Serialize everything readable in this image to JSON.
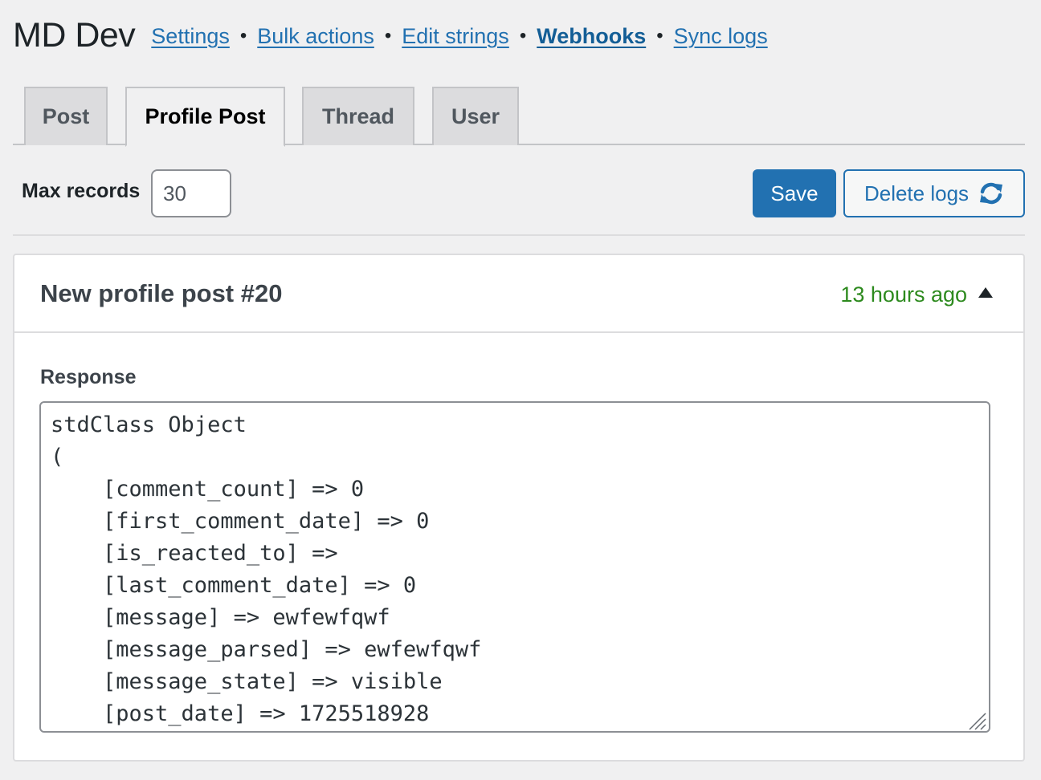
{
  "header": {
    "app_title": "MD Dev",
    "nav": [
      {
        "label": "Settings",
        "current": false
      },
      {
        "label": "Bulk actions",
        "current": false
      },
      {
        "label": "Edit strings",
        "current": false
      },
      {
        "label": "Webhooks",
        "current": true
      },
      {
        "label": "Sync logs",
        "current": false
      }
    ],
    "separator": "•"
  },
  "tabs": [
    {
      "label": "Post",
      "active": false
    },
    {
      "label": "Profile Post",
      "active": true
    },
    {
      "label": "Thread",
      "active": false
    },
    {
      "label": "User",
      "active": false
    }
  ],
  "settings": {
    "max_records_label": "Max records",
    "max_records_value": "30",
    "save_label": "Save",
    "delete_logs_label": "Delete logs",
    "delete_icon": "refresh-icon"
  },
  "log": {
    "title": "New profile post #20",
    "time": "13 hours ago",
    "expanded": true,
    "response_label": "Response",
    "response_lines": [
      "stdClass Object",
      "(",
      "    [comment_count] => 0",
      "    [first_comment_date] => 0",
      "    [is_reacted_to] =>",
      "    [last_comment_date] => 0",
      "    [message] => ewfewfqwf",
      "    [message_parsed] => ewfewfqwf",
      "    [message_state] => visible",
      "    [post_date] => 1725518928"
    ]
  },
  "colors": {
    "link": "#2271b1",
    "primary": "#2271b1",
    "time_green": "#2d8a1e",
    "background": "#f0f0f1"
  }
}
